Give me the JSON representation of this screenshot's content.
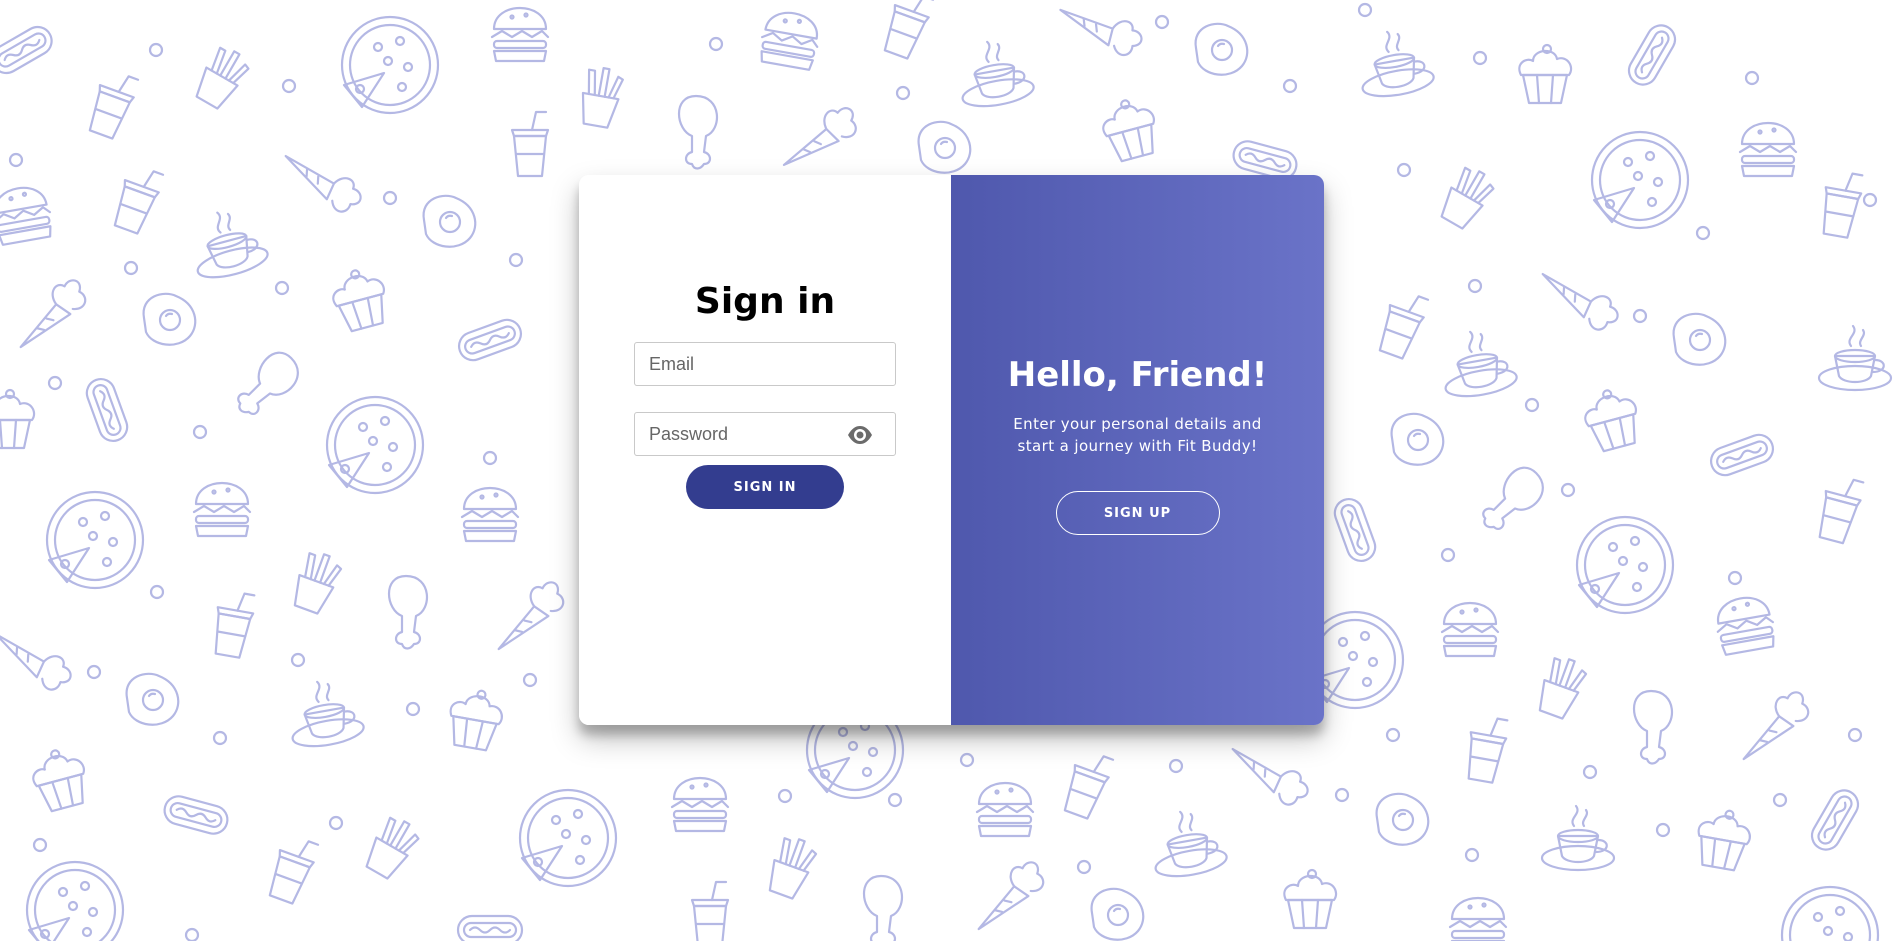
{
  "signin": {
    "title": "Sign in",
    "email_placeholder": "Email",
    "password_placeholder": "Password",
    "password_toggle_icon": "eye-icon",
    "button_label": "SIGN IN"
  },
  "signup": {
    "title": "Hello, Friend!",
    "description": "Enter your personal details and start a journey with Fit Buddy!",
    "button_label": "SIGN UP"
  },
  "background": {
    "pattern_icons": [
      "pizza-icon",
      "burger-icon",
      "hotdog-icon",
      "fries-icon",
      "drink-cup-icon",
      "fried-egg-icon",
      "carrot-icon",
      "chicken-leg-icon",
      "cupcake-icon",
      "coffee-cup-icon"
    ]
  },
  "colors": {
    "pattern": "#b4b8e4",
    "signin_button": "#333d8f",
    "overlay_gradient_start": "#4f58ad",
    "overlay_gradient_end": "#6a73c8"
  }
}
